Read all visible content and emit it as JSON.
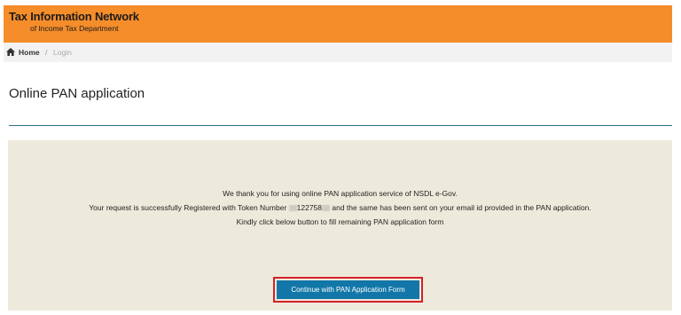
{
  "header": {
    "title": "Tax Information Network",
    "subtitle": "of Income Tax Department",
    "color": "#f58d2a"
  },
  "breadcrumb": {
    "icon": "home-icon",
    "home": "Home",
    "separator": "/",
    "current": "Login"
  },
  "page": {
    "title": "Online PAN application"
  },
  "message": {
    "line1": "We thank you for using online PAN application service of NSDL e-Gov.",
    "line2_prefix": "Your request is successfully Registered with Token Number ",
    "token_visible": "122758",
    "line2_suffix": " and the same has been sent on your email id provided in the PAN application.",
    "line3": "Kindly click below button to fill remaining PAN application form"
  },
  "actions": {
    "continue_label": "Continue with PAN Application Form",
    "button_color": "#1277a8",
    "highlight_color": "#d4202a"
  }
}
